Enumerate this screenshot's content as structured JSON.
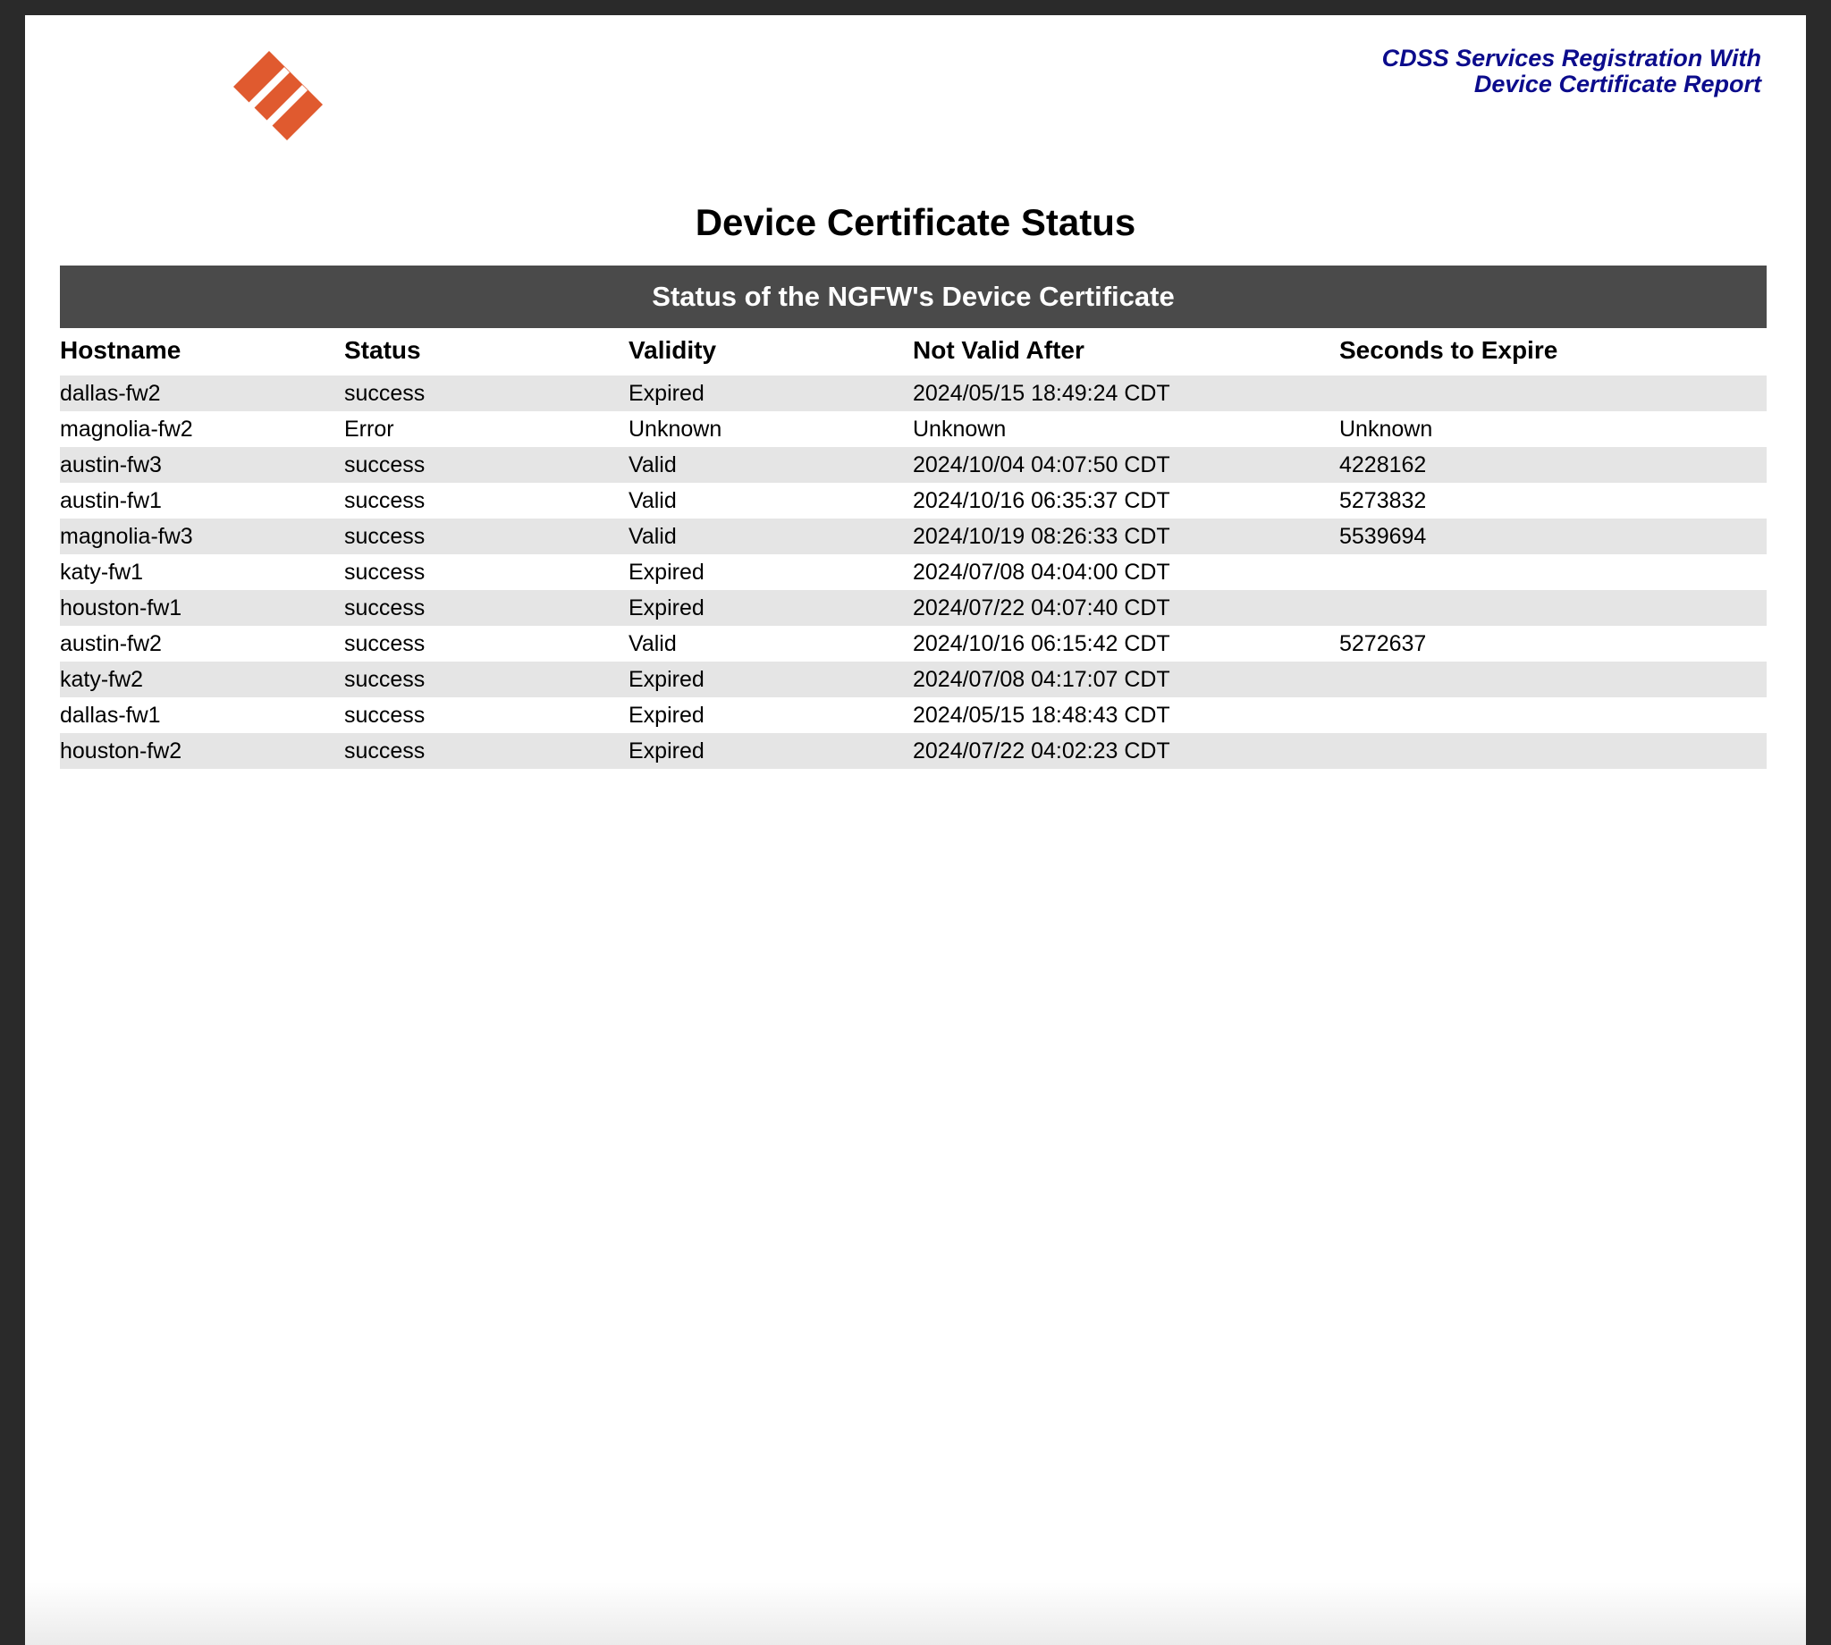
{
  "report": {
    "title_line1": "CDSS Services Registration With",
    "title_line2": "Device Certificate Report"
  },
  "brand": {
    "logo_icon": "paloalto-logo-icon",
    "logo_color": "#e05a2f"
  },
  "section": {
    "heading": "Device Certificate Status"
  },
  "table": {
    "caption": "Status of the NGFW's Device Certificate",
    "headers": [
      "Hostname",
      "Status",
      "Validity",
      "Not Valid After",
      "Seconds to Expire"
    ],
    "rows": [
      {
        "hostname": "dallas-fw2",
        "status": "success",
        "validity": "Expired",
        "not_valid_after": "2024/05/15 18:49:24 CDT",
        "seconds": ""
      },
      {
        "hostname": "magnolia-fw2",
        "status": "Error",
        "validity": "Unknown",
        "not_valid_after": "Unknown",
        "seconds": "Unknown"
      },
      {
        "hostname": "austin-fw3",
        "status": "success",
        "validity": "Valid",
        "not_valid_after": "2024/10/04 04:07:50 CDT",
        "seconds": "4228162"
      },
      {
        "hostname": "austin-fw1",
        "status": "success",
        "validity": "Valid",
        "not_valid_after": "2024/10/16 06:35:37 CDT",
        "seconds": "5273832"
      },
      {
        "hostname": "magnolia-fw3",
        "status": "success",
        "validity": "Valid",
        "not_valid_after": "2024/10/19 08:26:33 CDT",
        "seconds": "5539694"
      },
      {
        "hostname": "katy-fw1",
        "status": "success",
        "validity": "Expired",
        "not_valid_after": "2024/07/08 04:04:00 CDT",
        "seconds": ""
      },
      {
        "hostname": "houston-fw1",
        "status": "success",
        "validity": "Expired",
        "not_valid_after": "2024/07/22 04:07:40 CDT",
        "seconds": ""
      },
      {
        "hostname": "austin-fw2",
        "status": "success",
        "validity": "Valid",
        "not_valid_after": "2024/10/16 06:15:42 CDT",
        "seconds": "5272637"
      },
      {
        "hostname": "katy-fw2",
        "status": "success",
        "validity": "Expired",
        "not_valid_after": "2024/07/08 04:17:07 CDT",
        "seconds": ""
      },
      {
        "hostname": "dallas-fw1",
        "status": "success",
        "validity": "Expired",
        "not_valid_after": "2024/05/15 18:48:43 CDT",
        "seconds": ""
      },
      {
        "hostname": "houston-fw2",
        "status": "success",
        "validity": "Expired",
        "not_valid_after": "2024/07/22 04:02:23 CDT",
        "seconds": ""
      }
    ]
  }
}
